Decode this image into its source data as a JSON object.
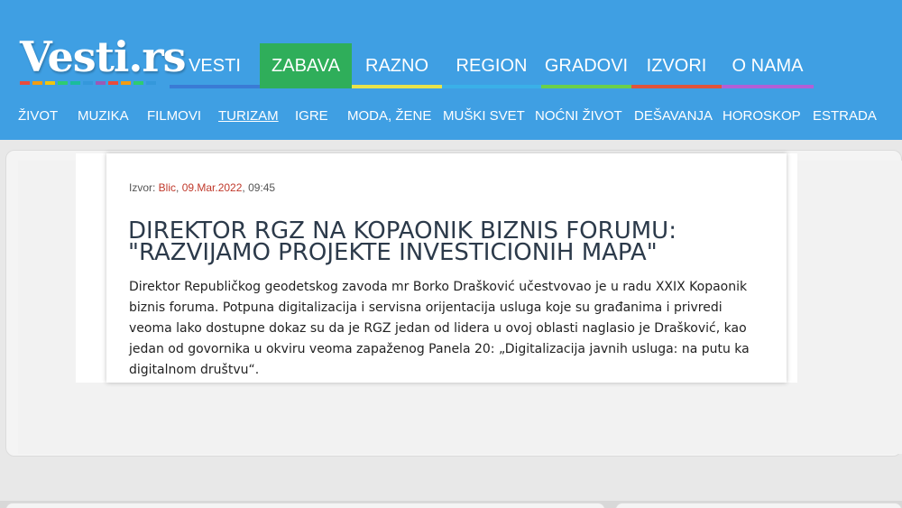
{
  "brand": {
    "logo_text": "Vesti.rs",
    "header_color": "#3f9fe3",
    "stripe_colors": [
      "#e84c3d",
      "#f39c12",
      "#f1c40f",
      "#2ecc71",
      "#1abc9c",
      "#3498db",
      "#9b59b6",
      "#e84c3d",
      "#f39c12",
      "#2ecc71",
      "#3498db"
    ]
  },
  "main_nav": [
    {
      "label": "VESTI",
      "bar_color": "#3a7bd5",
      "active": false
    },
    {
      "label": "ZABAVA",
      "bar_color": "#2fae5a",
      "active": true
    },
    {
      "label": "RAZNO",
      "bar_color": "#e8e34a",
      "active": false
    },
    {
      "label": "REGION",
      "bar_color": "#3ab0e8",
      "active": false
    },
    {
      "label": "GRADOVI",
      "bar_color": "#6ad04a",
      "active": false
    },
    {
      "label": "IZVORI",
      "bar_color": "#e0533b",
      "active": false
    },
    {
      "label": "O NAMA",
      "bar_color": "#b25fd6",
      "active": false
    }
  ],
  "sub_nav": [
    {
      "label": "ŽIVOT",
      "active": false
    },
    {
      "label": "MUZIKA",
      "active": false
    },
    {
      "label": "FILMOVI",
      "active": false
    },
    {
      "label": "TURIZAM",
      "active": true
    },
    {
      "label": "IGRE",
      "active": false
    },
    {
      "label": "MODA, ŽENE",
      "active": false
    },
    {
      "label": "MUŠKI SVET",
      "active": false
    },
    {
      "label": "NOĆNI ŽIVOT",
      "active": false
    },
    {
      "label": "DEŠAVANJA",
      "active": false
    },
    {
      "label": "HOROSKOP",
      "active": false
    },
    {
      "label": "ESTRADA",
      "active": false
    }
  ],
  "article": {
    "source_prefix": "Izvor: ",
    "source_name": "Blic",
    "source_sep": ", ",
    "source_date": "09.Mar.2022",
    "source_time": ", 09:45",
    "title": "DIREKTOR RGZ NA KOPAONIK BIZNIS FORUMU: \"RAZVIJAMO PROJEKTE INVESTICIONIH MAPA\"",
    "body": "Direktor Republičkog geodetskog zavoda mr Borko Drašković učestvovao je u radu XXIX Kopaonik biznis foruma. Potpuna digitalizacija i servisna orijentacija usluga koje su građanima i privredi veoma lako dostupne dokaz su da je RGZ jedan od lidera u ovoj oblasti naglasio je Drašković, kao jedan od govornika u okviru veoma zapaženog Panela 20: „Digitalizacija javnih usluga: na putu ka digitalnom društvu“."
  }
}
